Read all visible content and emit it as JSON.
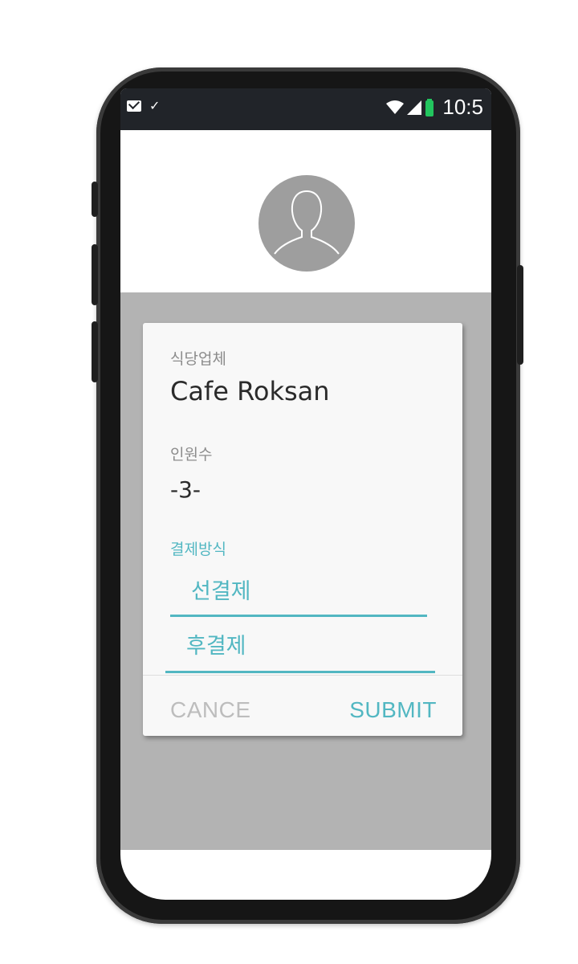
{
  "status_bar": {
    "time": "10:5",
    "left_icons": [
      "mail-icon",
      "check-icon"
    ],
    "right_icons": [
      "wifi-icon",
      "signal-icon",
      "battery-icon"
    ]
  },
  "profile": {
    "avatar_icon": "person-silhouette-icon"
  },
  "dialog": {
    "restaurant": {
      "label": "식당업체",
      "value": "Cafe Roksan"
    },
    "headcount": {
      "label": "인원수",
      "value": "-3-"
    },
    "payment": {
      "label": "결제방식",
      "options": [
        "선결제",
        "후결제"
      ]
    },
    "actions": {
      "cancel": "CANCE",
      "submit": "SUBMIT"
    }
  },
  "colors": {
    "accent": "#52b7c2",
    "status_bar": "#212429",
    "overlay": "#b3b3b3",
    "dialog": "#f8f8f8",
    "battery": "#22c55e"
  }
}
